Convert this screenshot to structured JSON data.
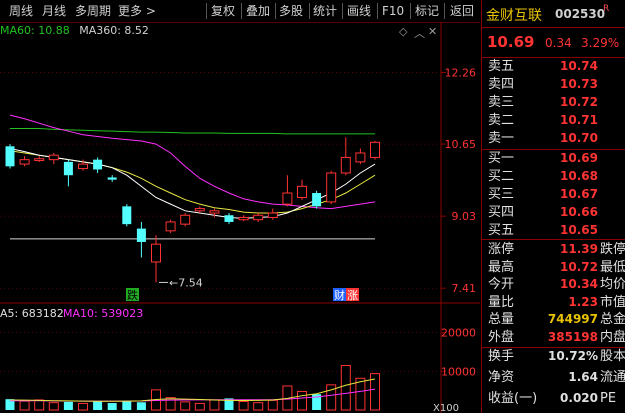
{
  "toolbar": {
    "items": [
      "周线",
      "月线",
      "多周期",
      "更多 >",
      "复权",
      "叠加",
      "多股",
      "统计",
      "画线",
      "F10",
      "标记",
      "返回"
    ]
  },
  "legend": {
    "ma60": "MA60: 10.88",
    "ma360": "MA360: 8.52",
    "vol_ma5": "A5: 683182",
    "vol_ma10": "MA10: 539023"
  },
  "stock": {
    "name": "金财互联",
    "code": "002530",
    "badge": "R",
    "price": "10.69",
    "change": "0.34",
    "change_pct": "3.29%"
  },
  "orderbook": {
    "asks": [
      {
        "label": "卖五",
        "price": "10.74"
      },
      {
        "label": "卖四",
        "price": "10.73"
      },
      {
        "label": "卖三",
        "price": "10.72"
      },
      {
        "label": "卖二",
        "price": "10.71"
      },
      {
        "label": "卖一",
        "price": "10.70"
      }
    ],
    "bids": [
      {
        "label": "买一",
        "price": "10.69"
      },
      {
        "label": "买二",
        "price": "10.68"
      },
      {
        "label": "买三",
        "price": "10.67"
      },
      {
        "label": "买四",
        "price": "10.66"
      },
      {
        "label": "买五",
        "price": "10.65"
      }
    ]
  },
  "stats": [
    {
      "label": "涨停",
      "value": "11.39",
      "extra": "跌停"
    },
    {
      "label": "最高",
      "value": "10.72",
      "extra": "最低"
    },
    {
      "label": "今开",
      "value": "10.34",
      "extra": "均价"
    },
    {
      "label": "量比",
      "value": "1.23",
      "extra": "市值"
    },
    {
      "label": "总量",
      "value": "744997",
      "extra": "总金"
    },
    {
      "label": "外盘",
      "value": "385198",
      "extra": "内盘"
    }
  ],
  "stats2": [
    {
      "label": "换手",
      "value": "10.72%",
      "extra": "股本"
    },
    {
      "label": "净资",
      "value": "1.64",
      "extra": "流通"
    },
    {
      "label": "收益(一)",
      "value": "0.020",
      "extra": "PE"
    }
  ],
  "chart_data": [
    {
      "type": "candlestick",
      "price_ticks": [
        "12.26",
        "10.65",
        "9.03",
        "7.41"
      ],
      "low_label": "7.54",
      "markers": [
        "跌",
        "财",
        "涨"
      ],
      "candles": [
        {
          "o": 10.6,
          "c": 10.15,
          "h": 10.65,
          "l": 10.1
        },
        {
          "o": 10.2,
          "c": 10.3,
          "h": 10.38,
          "l": 10.15
        },
        {
          "o": 10.28,
          "c": 10.32,
          "h": 10.38,
          "l": 10.25
        },
        {
          "o": 10.3,
          "c": 10.4,
          "h": 10.45,
          "l": 10.2
        },
        {
          "o": 10.25,
          "c": 9.95,
          "h": 10.3,
          "l": 9.7
        },
        {
          "o": 10.1,
          "c": 10.2,
          "h": 10.3,
          "l": 10.05
        },
        {
          "o": 10.3,
          "c": 10.08,
          "h": 10.35,
          "l": 10.0
        },
        {
          "o": 9.9,
          "c": 9.85,
          "h": 9.95,
          "l": 9.8
        },
        {
          "o": 9.25,
          "c": 8.85,
          "h": 9.3,
          "l": 8.8
        },
        {
          "o": 8.75,
          "c": 8.45,
          "h": 8.9,
          "l": 8.1
        },
        {
          "o": 8.0,
          "c": 8.4,
          "h": 8.6,
          "l": 7.54
        },
        {
          "o": 8.7,
          "c": 8.9,
          "h": 8.95,
          "l": 8.65
        },
        {
          "o": 8.85,
          "c": 9.05,
          "h": 9.1,
          "l": 8.8
        },
        {
          "o": 9.15,
          "c": 9.2,
          "h": 9.25,
          "l": 9.1
        },
        {
          "o": 9.1,
          "c": 9.15,
          "h": 9.2,
          "l": 9.0
        },
        {
          "o": 9.05,
          "c": 8.9,
          "h": 9.1,
          "l": 8.85
        },
        {
          "o": 8.95,
          "c": 9.0,
          "h": 9.05,
          "l": 8.92
        },
        {
          "o": 8.95,
          "c": 9.05,
          "h": 9.1,
          "l": 8.9
        },
        {
          "o": 9.0,
          "c": 9.1,
          "h": 9.2,
          "l": 8.95
        },
        {
          "o": 9.3,
          "c": 9.55,
          "h": 9.95,
          "l": 9.25
        },
        {
          "o": 9.45,
          "c": 9.7,
          "h": 9.85,
          "l": 9.4
        },
        {
          "o": 9.55,
          "c": 9.25,
          "h": 9.6,
          "l": 9.2
        },
        {
          "o": 9.35,
          "c": 10.0,
          "h": 10.05,
          "l": 9.3
        },
        {
          "o": 10.0,
          "c": 10.35,
          "h": 10.8,
          "l": 9.95
        },
        {
          "o": 10.25,
          "c": 10.45,
          "h": 10.55,
          "l": 10.2
        },
        {
          "o": 10.35,
          "c": 10.69,
          "h": 10.72,
          "l": 10.3
        }
      ],
      "ma_short": [
        10.55,
        10.48,
        10.4,
        10.35,
        10.3,
        10.25,
        10.2,
        10.12,
        9.95,
        9.7,
        9.45,
        9.3,
        9.15,
        9.1,
        9.05,
        9.0,
        8.98,
        9.0,
        9.02,
        9.1,
        9.25,
        9.4,
        9.55,
        9.75,
        10.0,
        10.2
      ],
      "ma_long": [
        10.5,
        10.45,
        10.4,
        10.35,
        10.3,
        10.25,
        10.2,
        10.12,
        10.02,
        9.88,
        9.7,
        9.55,
        9.4,
        9.3,
        9.22,
        9.18,
        9.12,
        9.1,
        9.1,
        9.12,
        9.2,
        9.3,
        9.4,
        9.55,
        9.75,
        9.95
      ],
      "ma60": [
        11.3,
        11.22,
        11.12,
        11.02,
        10.94,
        10.86,
        10.82,
        10.78,
        10.75,
        10.72,
        10.65,
        10.45,
        10.15,
        9.88,
        9.7,
        9.55,
        9.42,
        9.35,
        9.3,
        9.28,
        9.25,
        9.22,
        9.2,
        9.25,
        9.3,
        9.35
      ],
      "ma360": [
        8.52,
        8.52,
        8.52,
        8.52,
        8.52,
        8.52,
        8.52,
        8.52,
        8.52,
        8.52,
        8.52,
        8.52,
        8.52,
        8.52,
        8.52,
        8.52,
        8.52,
        8.52,
        8.52,
        8.52,
        8.52,
        8.52,
        8.52,
        8.52,
        8.52,
        8.52
      ],
      "ma_flat": [
        11.0,
        11.0,
        11.0,
        10.98,
        10.97,
        10.96,
        10.95,
        10.94,
        10.93,
        10.92,
        10.92,
        10.91,
        10.9,
        10.9,
        10.9,
        10.89,
        10.89,
        10.89,
        10.89,
        10.88,
        10.88,
        10.88,
        10.88,
        10.88,
        10.88,
        10.88
      ]
    },
    {
      "type": "bar",
      "title": "volume",
      "ticks": [
        "20000",
        "10000"
      ],
      "unit": "X100",
      "volumes": [
        2800,
        2300,
        2600,
        1900,
        2100,
        1700,
        2200,
        1800,
        2400,
        2000,
        5200,
        3200,
        2100,
        1700,
        2600,
        3000,
        2200,
        1900,
        2500,
        6200,
        4800,
        4100,
        6500,
        11500,
        8200,
        9400
      ],
      "ma5": [
        2600,
        2550,
        2500,
        2400,
        2350,
        2300,
        2250,
        2250,
        2300,
        2350,
        2700,
        2900,
        2800,
        2700,
        2600,
        2500,
        2450,
        2500,
        2600,
        3000,
        3700,
        4200,
        5200,
        6400,
        7300,
        8000
      ],
      "ma10": [
        2400,
        2400,
        2380,
        2350,
        2330,
        2300,
        2290,
        2280,
        2300,
        2330,
        2450,
        2550,
        2600,
        2620,
        2640,
        2650,
        2650,
        2650,
        2660,
        2800,
        3100,
        3350,
        3800,
        4300,
        4800,
        5400
      ]
    }
  ]
}
